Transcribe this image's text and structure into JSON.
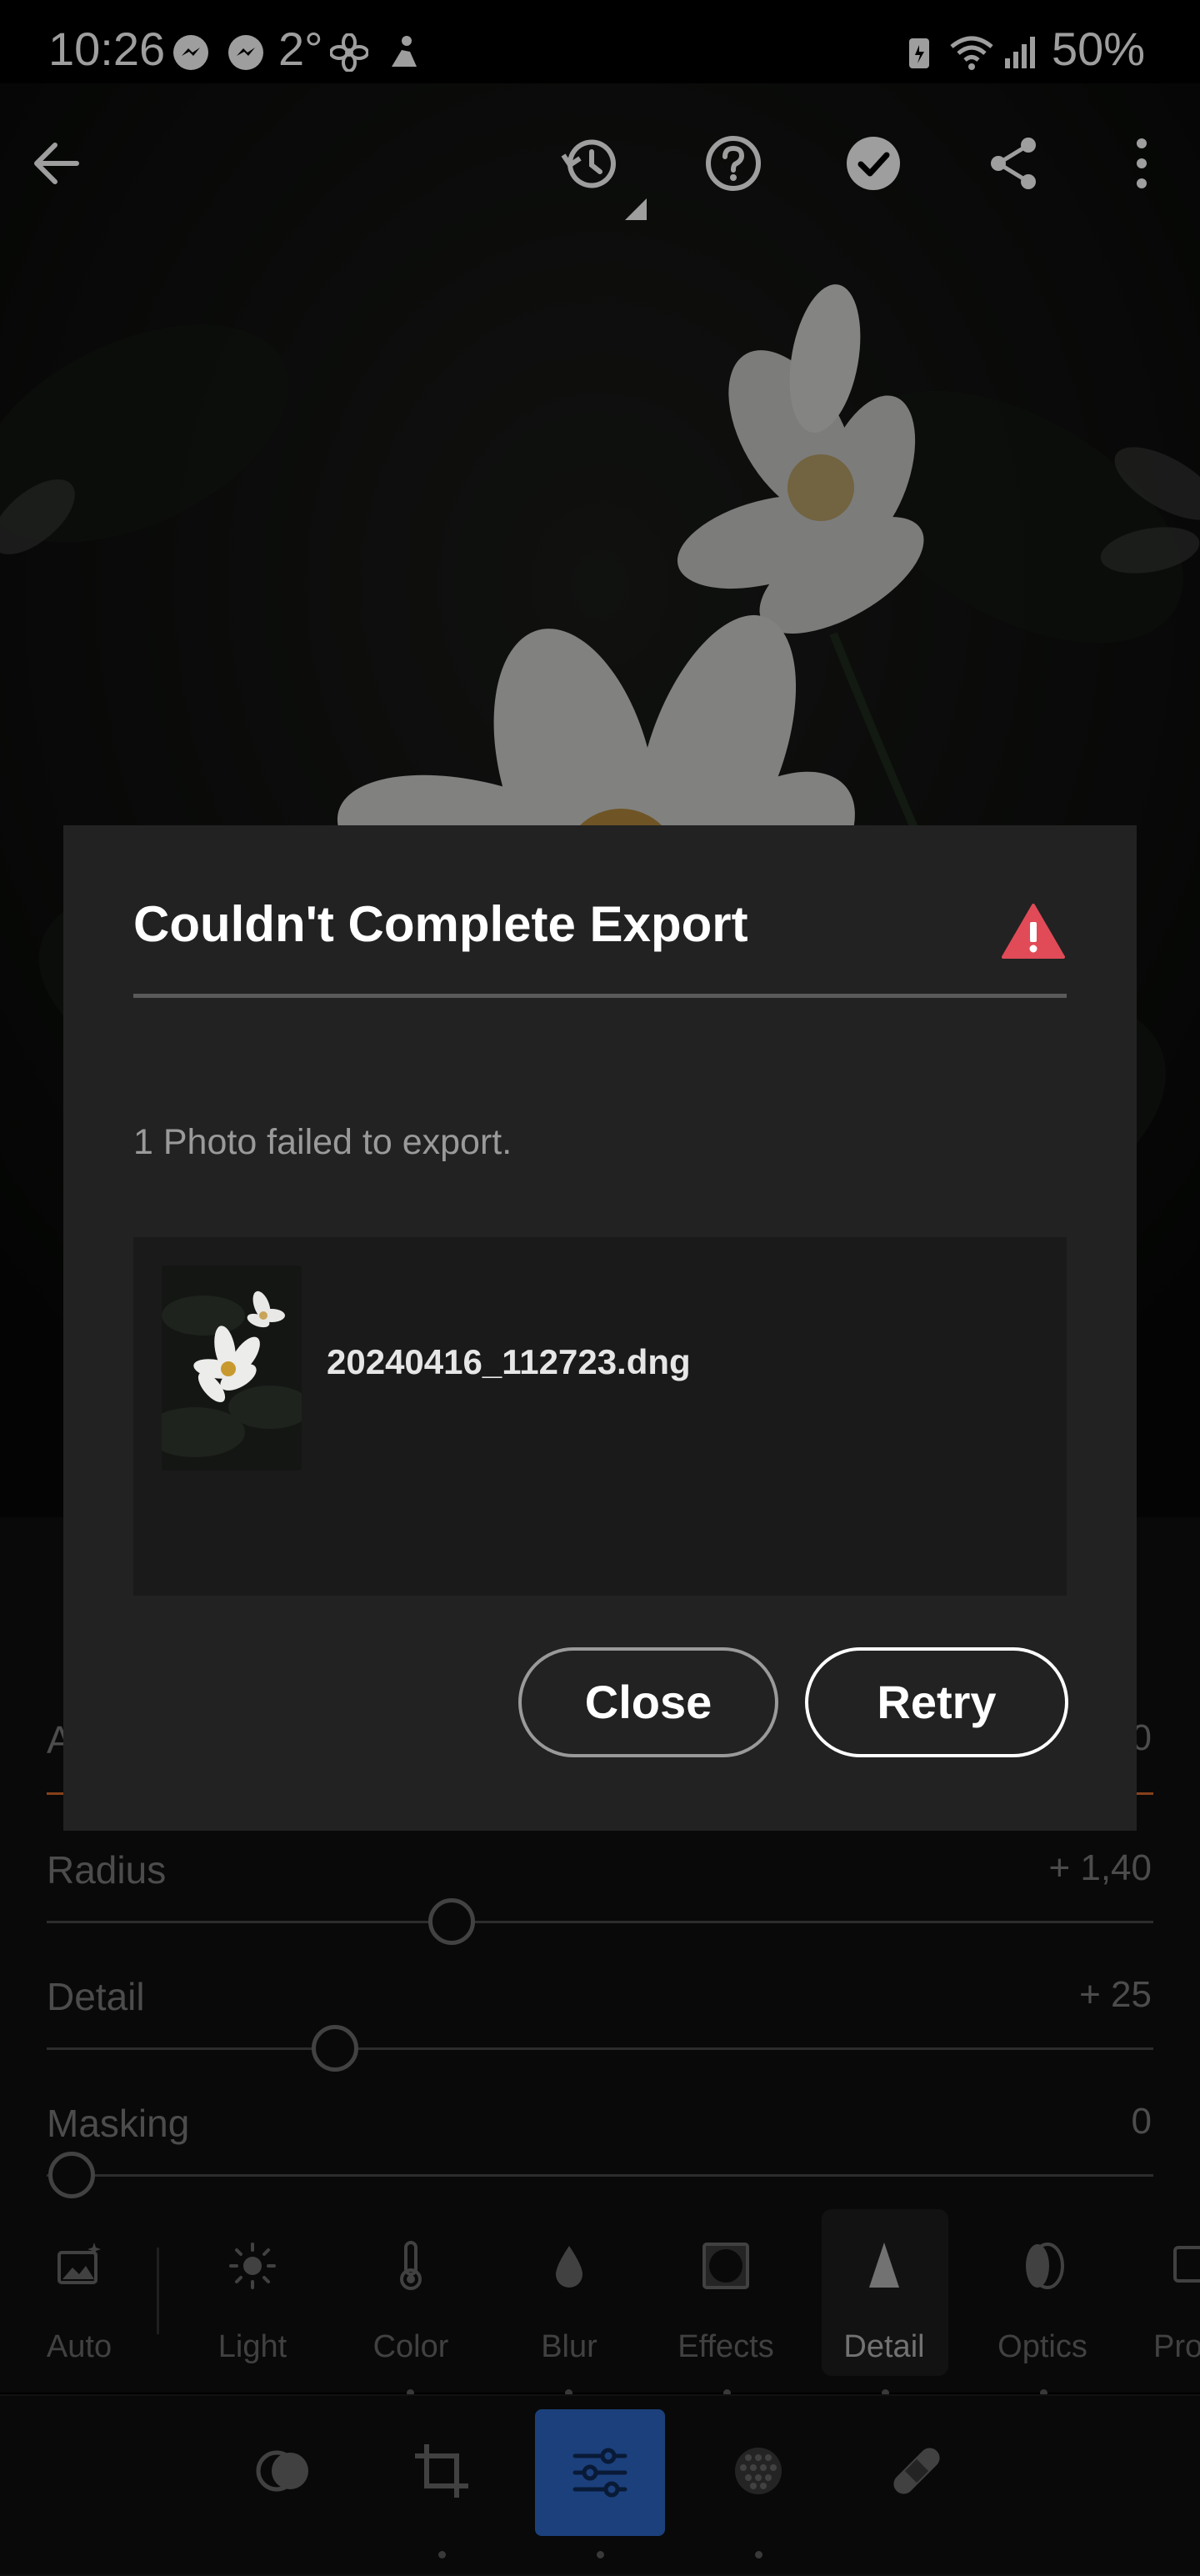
{
  "status_bar": {
    "time": "10:26",
    "temperature": "2°",
    "battery": "50%"
  },
  "editor": {
    "sliders": [
      {
        "label": "Radius",
        "value": "+ 1,40"
      },
      {
        "label": "Detail",
        "value": "+ 25"
      },
      {
        "label": "Masking",
        "value": "0"
      }
    ],
    "partial_label": "A",
    "partial_value": "0"
  },
  "tools": [
    {
      "label": "Auto",
      "icon": "auto-icon"
    },
    {
      "label": "Light",
      "icon": "sun-icon"
    },
    {
      "label": "Color",
      "icon": "thermometer-icon"
    },
    {
      "label": "Blur",
      "icon": "drop-icon"
    },
    {
      "label": "Effects",
      "icon": "vignette-icon"
    },
    {
      "label": "Detail",
      "icon": "triangle-icon"
    },
    {
      "label": "Optics",
      "icon": "lens-icon"
    },
    {
      "label": "Pro",
      "icon": "profile-icon"
    }
  ],
  "dialog": {
    "title": "Couldn't Complete Export",
    "message": "1 Photo failed to export.",
    "filename": "20240416_112723.dng",
    "close_label": "Close",
    "retry_label": "Retry"
  },
  "colors": {
    "accent": "#2c68c9",
    "warning": "#e04b57",
    "slider_accent": "#d86a2a"
  }
}
